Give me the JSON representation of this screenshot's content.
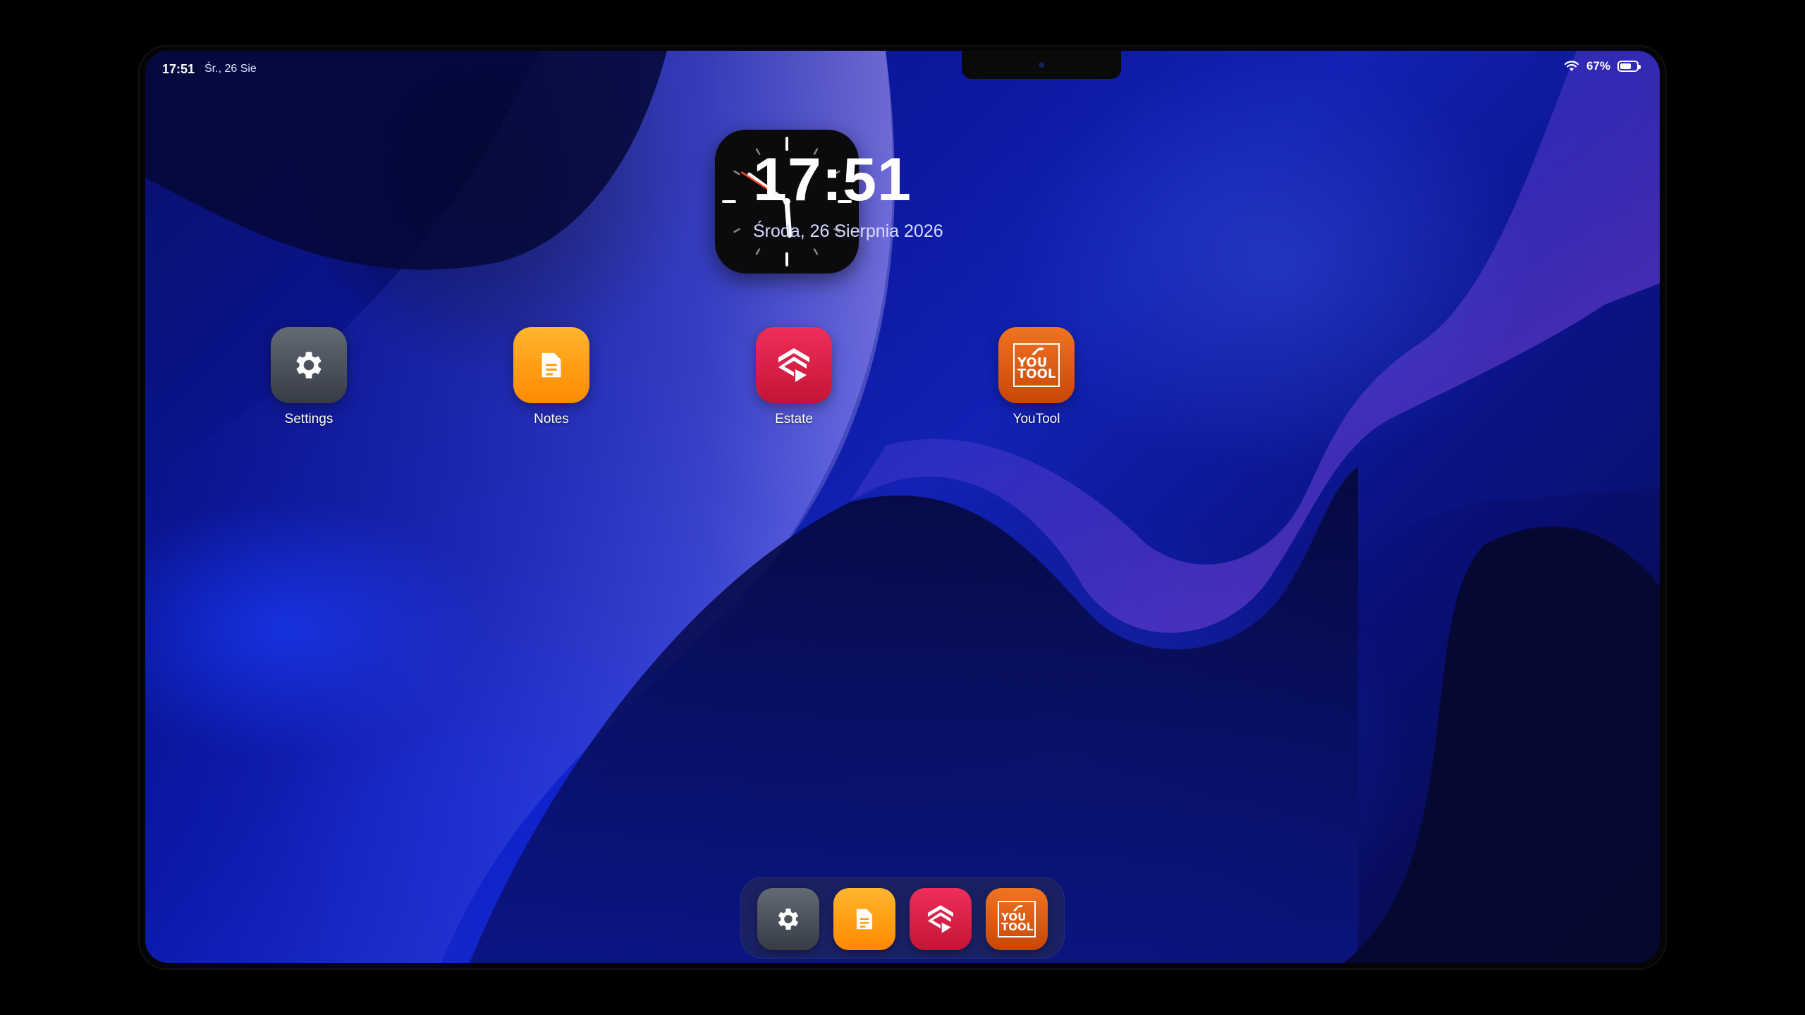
{
  "status_bar": {
    "time": "17:51",
    "date": "Śr., 26 Sie",
    "battery_percent": "67%",
    "battery_level": 0.67,
    "wifi_icon": "wifi-icon",
    "battery_icon": "battery-icon"
  },
  "clock_widget": {
    "time": "17:51",
    "date": "Środa, 26 Sierpnia 2026"
  },
  "apps": [
    {
      "label": "Settings",
      "icon": "gear-icon",
      "color": "#4a4f58"
    },
    {
      "label": "Notes",
      "icon": "note-icon",
      "color": "#ff9f12"
    },
    {
      "label": "Estate",
      "icon": "estate-logo-icon",
      "color": "#dc2047"
    },
    {
      "label": "YouTool",
      "icon": "youtool-logo-icon",
      "color": "#e0601a"
    }
  ],
  "youtool_logo_text": [
    "YOU",
    "TOOL"
  ],
  "dock": [
    "Settings",
    "Notes",
    "Estate",
    "YouTool"
  ]
}
